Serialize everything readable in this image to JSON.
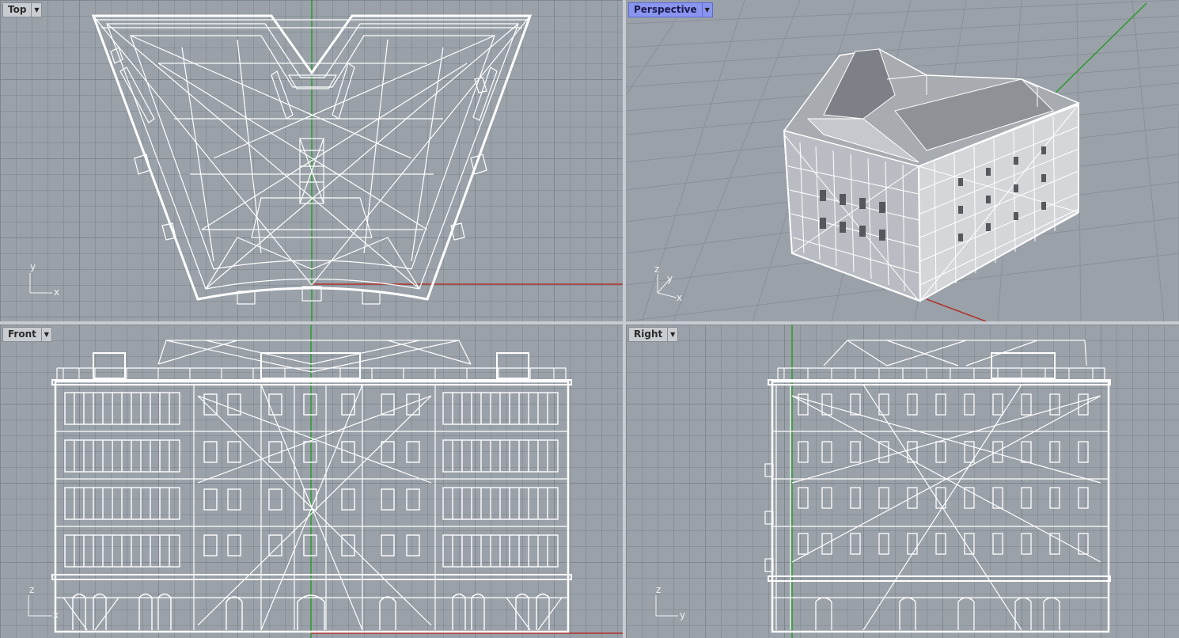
{
  "viewports": {
    "top": {
      "label": "Top",
      "axes": [
        "y",
        "x"
      ]
    },
    "perspective": {
      "label": "Perspective",
      "axes": [
        "z",
        "y",
        "x"
      ]
    },
    "front": {
      "label": "Front",
      "axes": [
        "z",
        "x"
      ]
    },
    "right": {
      "label": "Right",
      "axes": [
        "z",
        "y"
      ]
    }
  },
  "colors": {
    "viewport_bg": "#9aa1a9",
    "wire": "#ffffff",
    "x_axis": "#b0302a",
    "y_axis": "#2a9a2a",
    "active_tab": "#8a95f0"
  },
  "icons": {
    "dropdown": "triangle-down"
  }
}
